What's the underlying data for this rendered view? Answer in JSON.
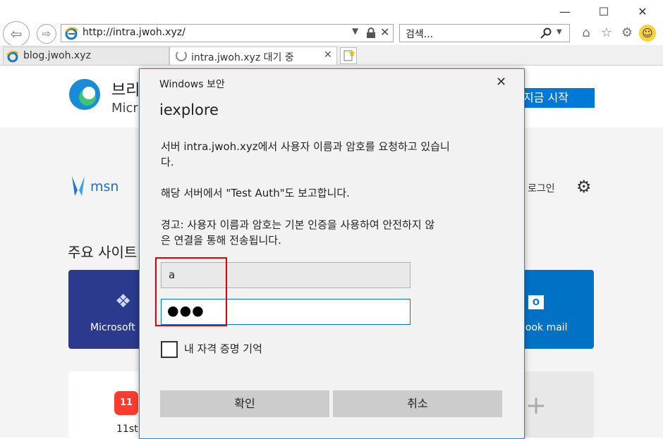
{
  "browser": {
    "address_url": "http://intra.jwoh.xyz/",
    "search_placeholder": "검색...",
    "tabs": [
      {
        "label": "blog.jwoh.xyz"
      },
      {
        "label": "intra.jwoh.xyz 대기 중"
      }
    ]
  },
  "page": {
    "banner_title": "브리",
    "banner_sub": "Micr",
    "banner_button": "지금 시작",
    "msn_label": "msn",
    "login_label": "로그인",
    "top_sites_heading": "주요 사이트",
    "tiles": {
      "microsoft": "Microsoft",
      "outlook": "look mail",
      "elevenst": "11st"
    }
  },
  "dialog": {
    "header": "Windows 보안",
    "app_name": "iexplore",
    "message_line1": "서버 intra.jwoh.xyz에서 사용자 이름과 암호를 요청하고 있습니",
    "message_line2": "다.",
    "report_text": "해당 서버에서 \"Test Auth\"도 보고합니다.",
    "warning_line1": "경고: 사용자 이름과 암호는 기본 인증을 사용하여 안전하지 않",
    "warning_line2": "은 연결을 통해 전송됩니다.",
    "username_value": "a",
    "password_mask": "●●●",
    "remember_label": "내 자격 증명 기억",
    "ok_label": "확인",
    "cancel_label": "취소"
  },
  "colors": {
    "accent": "#0078d7",
    "highlight_box": "#e00000",
    "tile_blue": "#2b3a8c",
    "tile_outlook": "#0072c6"
  }
}
